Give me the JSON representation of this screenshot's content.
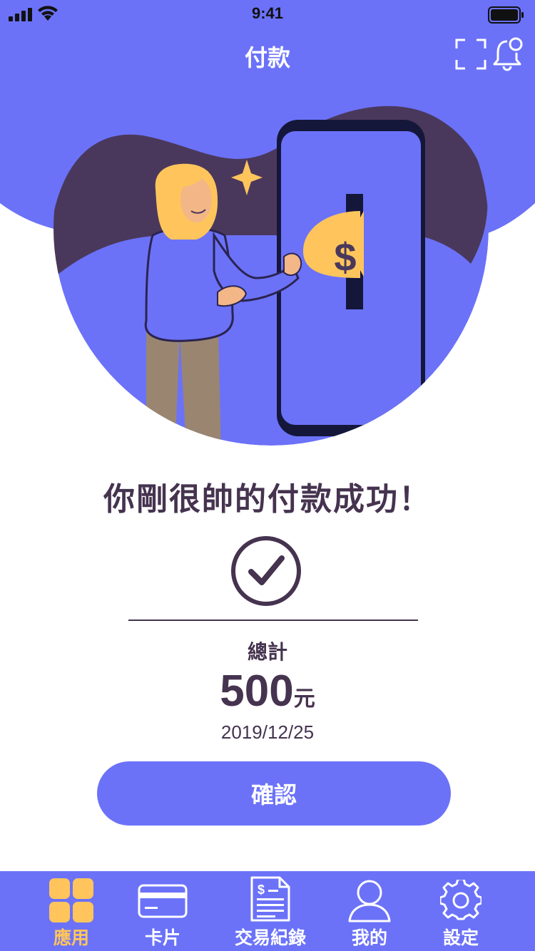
{
  "status_bar": {
    "time": "9:41"
  },
  "header": {
    "title": "付款",
    "scan_icon": "scan-frame-icon",
    "bell_icon": "bell-icon"
  },
  "illustration": {
    "icon": "payment-illustration",
    "coin_symbol": "$"
  },
  "result": {
    "message": "你剛很帥的付款成功！",
    "icon": "check-circle-icon",
    "total_label": "總計",
    "amount": "500",
    "unit": "元",
    "date": "2019/12/25"
  },
  "confirm_label": "確認",
  "tab_bar": {
    "active_color": "#ffc55c",
    "items": [
      {
        "label": "應用",
        "icon": "apps-grid-icon",
        "active": true
      },
      {
        "label": "卡片",
        "icon": "credit-card-icon",
        "active": false
      },
      {
        "label": "交易紀錄",
        "icon": "receipt-icon",
        "active": false
      },
      {
        "label": "我的",
        "icon": "user-icon",
        "active": false
      },
      {
        "label": "設定",
        "icon": "gear-icon",
        "active": false
      }
    ]
  },
  "colors": {
    "primary": "#6b72f8",
    "dark": "#45334f",
    "accent": "#ffc55c"
  }
}
